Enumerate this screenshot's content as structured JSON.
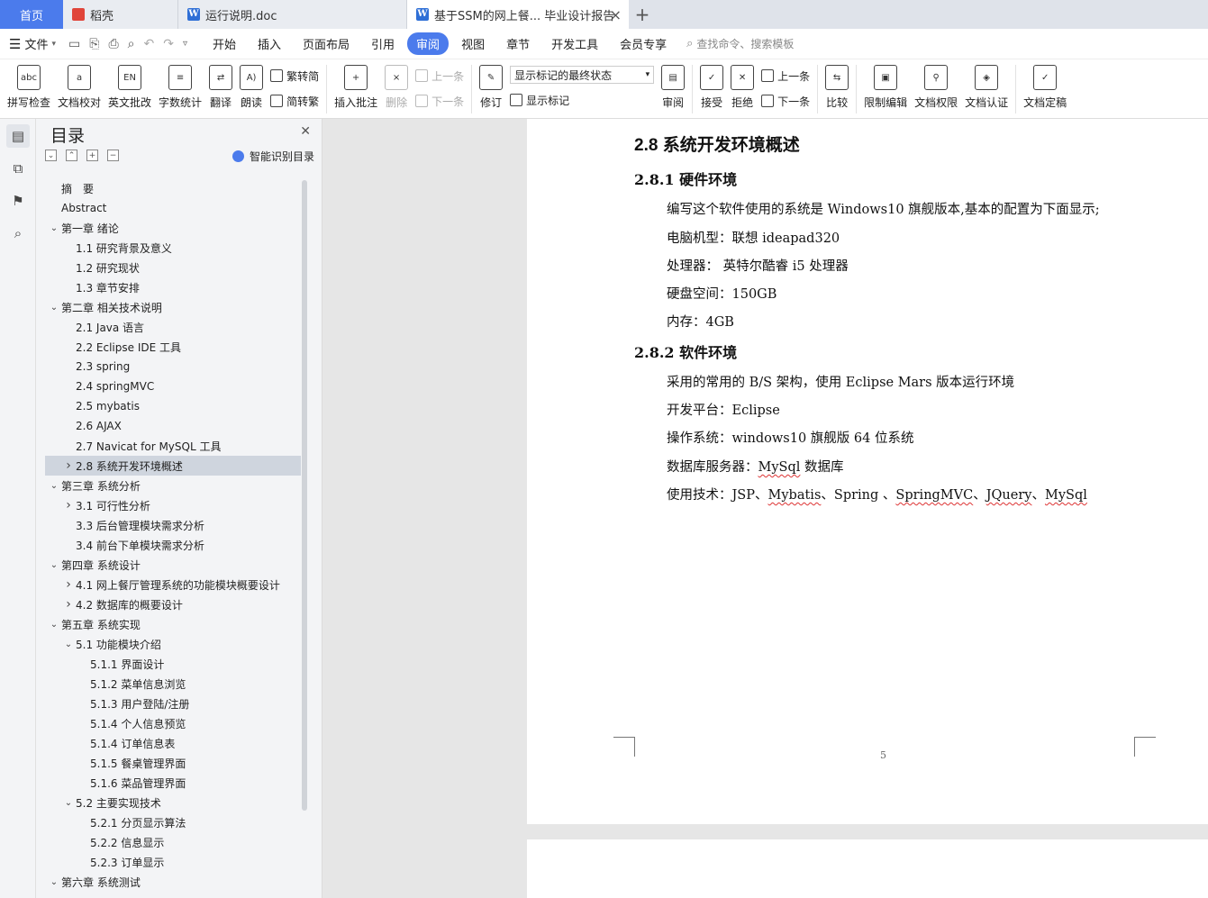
{
  "tabs": {
    "home": "首页",
    "t1": "稻壳",
    "t2": "运行说明.doc",
    "active": "基于SSM的网上餐...  毕业设计报告"
  },
  "menu": {
    "file": "文件",
    "items": [
      "开始",
      "插入",
      "页面布局",
      "引用",
      "审阅",
      "视图",
      "章节",
      "开发工具",
      "会员专享"
    ],
    "search": "查找命令、搜索模板"
  },
  "ribbon": {
    "spell": "拼写检查",
    "proof": "文档校对",
    "en_review": "英文批改",
    "wordcount": "字数统计",
    "translate": "翻译",
    "read": "朗读",
    "to_trad": "繁转简",
    "to_simp": "简转繁",
    "insert_comment": "插入批注",
    "delete": "删除",
    "prev1": "上一条",
    "next1": "下一条",
    "revise": "修订",
    "markup_state": "显示标记的最终状态",
    "show_markup": "显示标记",
    "review": "审阅",
    "accept": "接受",
    "reject": "拒绝",
    "prev2": "上一条",
    "next2": "下一条",
    "compare": "比较",
    "restrict": "限制编辑",
    "rights": "文档权限",
    "auth": "文档认证",
    "finalize": "文档定稿"
  },
  "toc": {
    "title": "目录",
    "smart": "智能识别目录",
    "items": [
      {
        "label": "摘　要",
        "caret": ""
      },
      {
        "label": "Abstract",
        "caret": ""
      },
      {
        "label": "第一章  绪论",
        "caret": "v"
      },
      {
        "label": "1.1 研究背景及意义",
        "caret": ""
      },
      {
        "label": "1.2 研究现状",
        "caret": ""
      },
      {
        "label": "1.3 章节安排",
        "caret": ""
      },
      {
        "label": "第二章  相关技术说明",
        "caret": "v"
      },
      {
        "label": "2.1 Java 语言",
        "caret": ""
      },
      {
        "label": "2.2 Eclipse IDE 工具",
        "caret": ""
      },
      {
        "label": "2.3 spring",
        "caret": ""
      },
      {
        "label": "2.4 springMVC",
        "caret": ""
      },
      {
        "label": "2.5 mybatis",
        "caret": ""
      },
      {
        "label": "2.6 AJAX",
        "caret": ""
      },
      {
        "label": "2.7 Navicat for MySQL 工具",
        "caret": ""
      },
      {
        "label": "2.8 系统开发环境概述",
        "caret": ">"
      },
      {
        "label": "第三章  系统分析",
        "caret": "v"
      },
      {
        "label": "3.1 可行性分析",
        "caret": ">"
      },
      {
        "label": "3.3 后台管理模块需求分析",
        "caret": ""
      },
      {
        "label": "3.4 前台下单模块需求分析",
        "caret": ""
      },
      {
        "label": "第四章  系统设计",
        "caret": "v"
      },
      {
        "label": "4.1 网上餐厅管理系统的功能模块概要设计",
        "caret": ">"
      },
      {
        "label": "4.2 数据库的概要设计",
        "caret": ">"
      },
      {
        "label": "第五章  系统实现",
        "caret": "v"
      },
      {
        "label": "5.1 功能模块介绍",
        "caret": "v"
      },
      {
        "label": "5.1.1 界面设计",
        "caret": ""
      },
      {
        "label": "5.1.2  菜单信息浏览",
        "caret": ""
      },
      {
        "label": "5.1.3  用户登陆/注册",
        "caret": ""
      },
      {
        "label": "5.1.4  个人信息预览",
        "caret": ""
      },
      {
        "label": "5.1.4  订单信息表",
        "caret": ""
      },
      {
        "label": "5.1.5  餐桌管理界面",
        "caret": ""
      },
      {
        "label": "5.1.6  菜品管理界面",
        "caret": ""
      },
      {
        "label": "5.2 主要实现技术",
        "caret": "v"
      },
      {
        "label": "5.2.1 分页显示算法",
        "caret": ""
      },
      {
        "label": "5.2.2  信息显示",
        "caret": ""
      },
      {
        "label": "5.2.3  订单显示",
        "caret": ""
      },
      {
        "label": "第六章  系统测试",
        "caret": "v"
      }
    ]
  },
  "doc": {
    "h2": "2.8 系统开发环境概述",
    "h3_hw": "2.8.1 硬件环境",
    "hw": [
      "编写这个软件使用的系统是 Windows10 旗舰版本,基本的配置为下面显示;",
      "电脑机型：联想  ideapad320",
      "处理器：  英特尔酷睿 i5 处理器",
      "硬盘空间：150GB",
      "内存：4GB"
    ],
    "h3_sw": "2.8.2 软件环境",
    "sw": [
      "采用的常用的 B/S 架构，使用 Eclipse Mars 版本运行环境",
      "开发平台：Eclipse",
      "操作系统：windows10 旗舰版  64 位系统"
    ],
    "db_prefix": "数据库服务器：",
    "db_wavy": "MySql",
    "db_suffix": " 数据库",
    "tech_prefix": "使用技术：JSP、",
    "tech_wavy1": "Mybatis",
    "tech_mid1": "、Spring 、",
    "tech_wavy2": "SpringMVC",
    "tech_mid2": "、",
    "tech_wavy3": "JQuery",
    "tech_mid3": "、",
    "tech_wavy4": "MySql",
    "page_number": "5"
  }
}
